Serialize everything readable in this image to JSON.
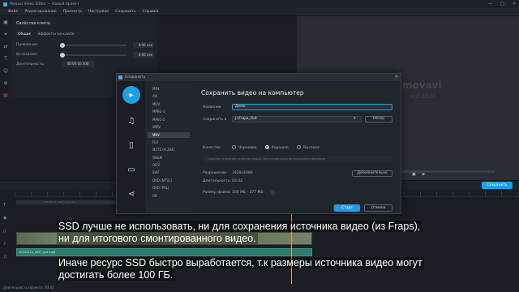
{
  "window": {
    "title": "Movavi Video Editor — Новый проект",
    "controls": [
      "—",
      "□",
      "✕"
    ]
  },
  "menu": [
    "Файл",
    "Редактирование",
    "Просмотр",
    "Настройки",
    "Сохранить",
    "Справка"
  ],
  "tools": [
    "media-icon",
    "filters-icon",
    "transitions-icon",
    "titles-icon",
    "stickers-icon",
    "zoom-icon",
    "more-icon"
  ],
  "clip_props": {
    "title": "Свойства клипа",
    "tabs": [
      "Общие",
      "Эффекты на клипе"
    ],
    "fade_in_label": "Появление:",
    "fade_in_value": "0.00 сек",
    "fade_out_label": "Исчезание:",
    "fade_out_value": "0.00 сек",
    "duration_label": "Длительность:",
    "duration_value": "00:00:00.000"
  },
  "preview": {
    "watermark_brand": "movavi",
    "watermark_edition": "e Editor"
  },
  "timeline": {
    "save_button": "Сохранить",
    "clip_name": "20141213_1837_ssd.mp4",
    "audio_clip_name": "20141213_1837_ssd.mp4",
    "status": "Длительность проекта: 03:42"
  },
  "subtitles": {
    "line1": "SSD лучше не использовать, ни для сохранения источника видео (из Fraps),",
    "line2": "ни для итогового смонтированного видео.",
    "line3": "Иначе ресурс SSD быстро выработается, т.к размеры источника видео могут",
    "line4": "достигать более 100 ГБ."
  },
  "dialog": {
    "window_title": "Сохранить",
    "heading": "Сохранить видео на компьютер",
    "formats": [
      "MP4",
      "AVI",
      "MOV",
      "MPEG-1",
      "MPEG-2",
      "WMV",
      "MKV",
      "FLV",
      "M2TS (H.264)",
      "WebM",
      "OGV",
      "SWF",
      "DVD (NTSC)",
      "DVD (PAL)",
      "GIF"
    ],
    "selected_format": "MKV",
    "name_label": "Название",
    "name_value": "Демо",
    "save_to_label": "Сохранить в",
    "save_to_value": "J:\\Fraps_Out",
    "browse_button": "Обзор",
    "quality_label": "Качество",
    "quality_options": [
      "Черновик",
      "Хорошее",
      "Высокое"
    ],
    "quality_selected": "Хорошее",
    "hint": "Среднее значение качества видео. Для сохранения оптимального формата",
    "resolution_label": "Разрешение",
    "resolution_value": "1920x1080",
    "duration_label": "Длительность",
    "duration_value": "03:42",
    "advanced_button": "Дополнительно",
    "filesize_label": "Размер файла",
    "filesize_value": "100 МБ - 377 МБ",
    "start_button": "Старт",
    "cancel_button": "Отмена"
  }
}
